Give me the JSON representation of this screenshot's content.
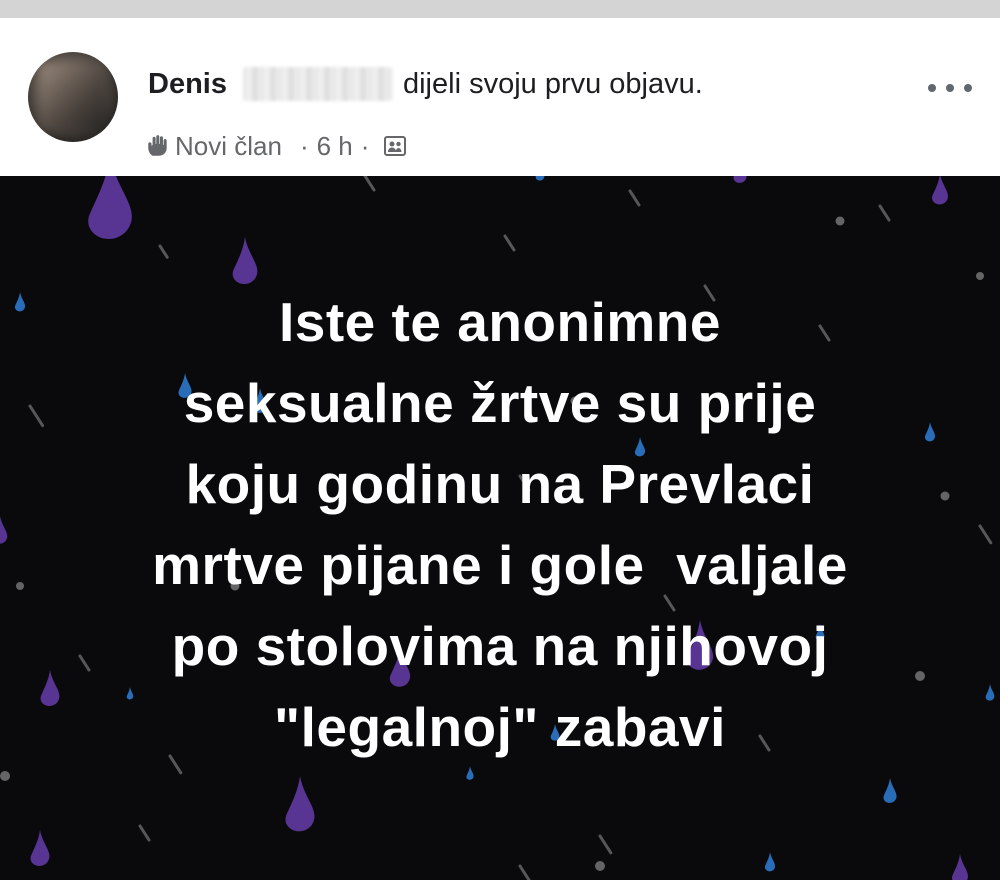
{
  "post": {
    "author_name": "Denis",
    "action_text": "dijeli svoju prvu objavu.",
    "badge_label": "Novi član",
    "time_ago": "6 h",
    "separator": "·",
    "audience_icon": "group-icon",
    "badge_icon": "waving-hand-icon",
    "more_icon": "more-options-icon"
  },
  "card": {
    "background_color": "#0a0a0c",
    "text_lines": [
      "Iste te anonimne",
      "seksualne žrtve su prije",
      "koju godinu na Prevlaci",
      "mrtve pijane i gole  valjale",
      "po stolovima na njihovoj",
      "\"legalnoj\" zabavi"
    ],
    "raindrop_colors": [
      "#6b3fb5",
      "#2f7fd8",
      "#8a8a8a"
    ]
  }
}
